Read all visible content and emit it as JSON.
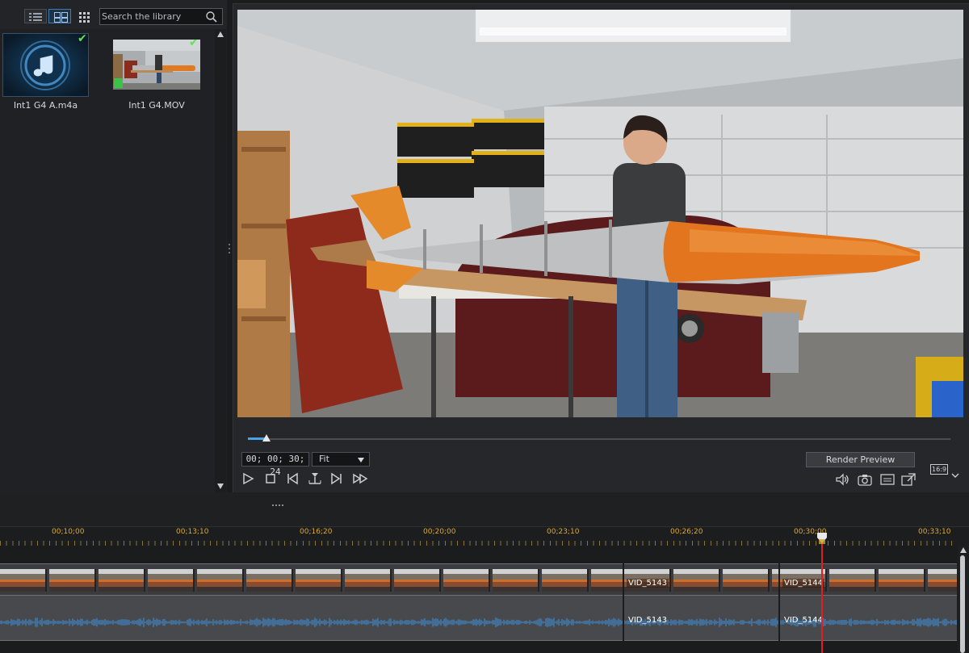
{
  "library": {
    "search_placeholder": "Search the library",
    "items": [
      {
        "name": "Int1 G4 A.m4a",
        "kind": "audio",
        "icon": "music-note-icon",
        "checked": true
      },
      {
        "name": "Int1 G4.MOV",
        "kind": "video",
        "icon": "video-thumbnail",
        "checked": true
      }
    ],
    "view_modes": [
      "details-view-icon",
      "thumbnail-view-icon",
      "grid-view-icon"
    ]
  },
  "preview": {
    "timecode": "00; 00; 30; 24",
    "zoom_value": "Fit",
    "render_preview_label": "Render Preview",
    "aspect_ratio": "16:9",
    "seek_position": 0.027
  },
  "timeline": {
    "ruler_ticks": [
      "00;10;00",
      "00;13;10",
      "00;16;20",
      "00;20;00",
      "00;23;10",
      "00;26;20",
      "00;30;00",
      "00;33;10"
    ],
    "clips": [
      {
        "video_label": "",
        "audio_label": ""
      },
      {
        "video_label": "VID_5143",
        "audio_label": "VID_5143"
      },
      {
        "video_label": "VID_5144",
        "audio_label": "VID_5144"
      }
    ]
  },
  "colors": {
    "accent": "#4aa3e6",
    "ruler_text": "#e0a92d",
    "playhead": "#e02020",
    "check": "#5ee35a",
    "waveform": "#3f86c8"
  }
}
